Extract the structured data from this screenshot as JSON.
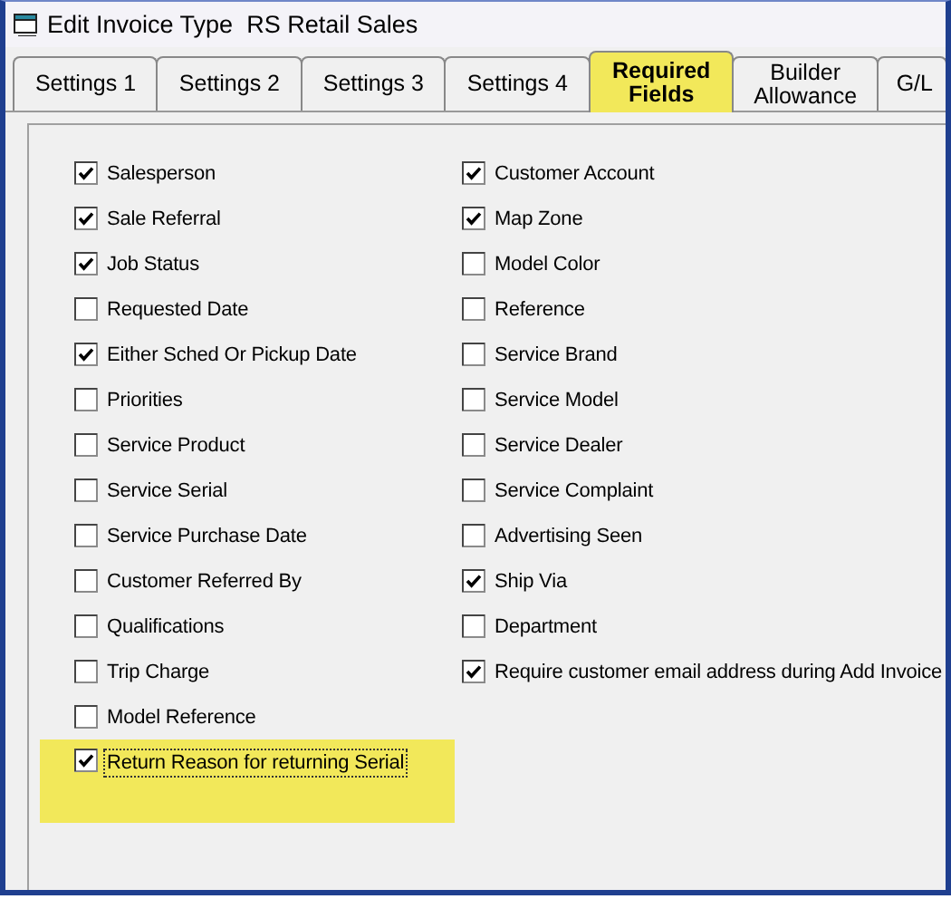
{
  "window": {
    "title": "Edit Invoice Type  RS Retail Sales"
  },
  "tabs": [
    {
      "label": "Settings 1",
      "selected": false,
      "highlighted": false
    },
    {
      "label": "Settings 2",
      "selected": false,
      "highlighted": false
    },
    {
      "label": "Settings 3",
      "selected": false,
      "highlighted": false
    },
    {
      "label": "Settings 4",
      "selected": false,
      "highlighted": false
    },
    {
      "label": "Required Fields",
      "selected": true,
      "highlighted": true
    },
    {
      "label": "Builder Allowance",
      "selected": false,
      "highlighted": false
    },
    {
      "label": "G/L",
      "selected": false,
      "highlighted": false
    }
  ],
  "left_column": [
    {
      "label": "Salesperson",
      "checked": true,
      "focused": false,
      "highlighted": false
    },
    {
      "label": "Sale Referral",
      "checked": true,
      "focused": false,
      "highlighted": false
    },
    {
      "label": "Job Status",
      "checked": true,
      "focused": false,
      "highlighted": false
    },
    {
      "label": "Requested Date",
      "checked": false,
      "focused": false,
      "highlighted": false
    },
    {
      "label": "Either Sched Or Pickup Date",
      "checked": true,
      "focused": false,
      "highlighted": false
    },
    {
      "label": "Priorities",
      "checked": false,
      "focused": false,
      "highlighted": false
    },
    {
      "label": "Service Product",
      "checked": false,
      "focused": false,
      "highlighted": false
    },
    {
      "label": "Service Serial",
      "checked": false,
      "focused": false,
      "highlighted": false
    },
    {
      "label": "Service Purchase Date",
      "checked": false,
      "focused": false,
      "highlighted": false
    },
    {
      "label": "Customer Referred By",
      "checked": false,
      "focused": false,
      "highlighted": false
    },
    {
      "label": "Qualifications",
      "checked": false,
      "focused": false,
      "highlighted": false
    },
    {
      "label": "Trip Charge",
      "checked": false,
      "focused": false,
      "highlighted": false
    },
    {
      "label": "Model Reference",
      "checked": false,
      "focused": false,
      "highlighted": false
    },
    {
      "label": "Return Reason for returning Serial",
      "checked": true,
      "focused": true,
      "highlighted": true
    }
  ],
  "right_column": [
    {
      "label": "Customer Account",
      "checked": true,
      "focused": false,
      "highlighted": false
    },
    {
      "label": "Map Zone",
      "checked": true,
      "focused": false,
      "highlighted": false
    },
    {
      "label": "Model Color",
      "checked": false,
      "focused": false,
      "highlighted": false
    },
    {
      "label": "Reference",
      "checked": false,
      "focused": false,
      "highlighted": false
    },
    {
      "label": "Service Brand",
      "checked": false,
      "focused": false,
      "highlighted": false
    },
    {
      "label": "Service Model",
      "checked": false,
      "focused": false,
      "highlighted": false
    },
    {
      "label": "Service Dealer",
      "checked": false,
      "focused": false,
      "highlighted": false
    },
    {
      "label": "Service Complaint",
      "checked": false,
      "focused": false,
      "highlighted": false
    },
    {
      "label": "Advertising Seen",
      "checked": false,
      "focused": false,
      "highlighted": false
    },
    {
      "label": "Ship Via",
      "checked": true,
      "focused": false,
      "highlighted": false
    },
    {
      "label": "Department",
      "checked": false,
      "focused": false,
      "highlighted": false
    },
    {
      "label": "Require customer email address during Add Invoice",
      "checked": true,
      "focused": false,
      "highlighted": false
    }
  ]
}
